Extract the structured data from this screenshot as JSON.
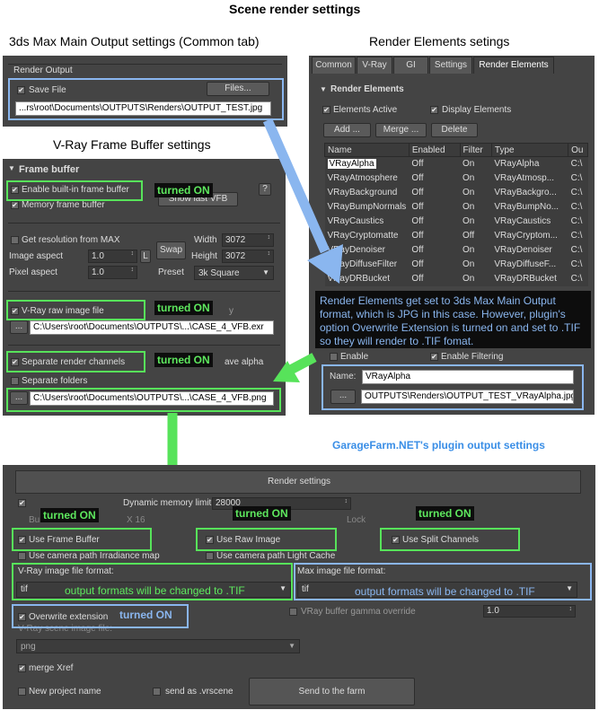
{
  "headings": {
    "main": "Scene render settings",
    "max_output": "3ds Max Main Output settings (Common tab)",
    "render_elements": "Render Elements setings",
    "vfb": "V-Ray Frame Buffer settings",
    "garagefarm": "GarageFarm.NET's plugin output settings"
  },
  "max_output": {
    "group": "Render Output",
    "save_file": "Save File",
    "files_btn": "Files...",
    "path": "...rs\\root\\Documents\\OUTPUTS\\Renders\\OUTPUT_TEST.jpg"
  },
  "render_elements": {
    "tabs": [
      "Common",
      "V-Ray",
      "GI",
      "Settings",
      "Render Elements"
    ],
    "rollout": "Render Elements",
    "elements_active": "Elements Active",
    "display_elements": "Display Elements",
    "add_btn": "Add ...",
    "merge_btn": "Merge ...",
    "delete_btn": "Delete",
    "columns": [
      "Name",
      "Enabled",
      "Filter",
      "Type",
      "Ou"
    ],
    "rows": [
      [
        "VRayAlpha",
        "Off",
        "On",
        "VRayAlpha",
        "C:\\"
      ],
      [
        "VRayAtmosphere",
        "Off",
        "On",
        "VRayAtmosp...",
        "C:\\"
      ],
      [
        "VRayBackground",
        "Off",
        "On",
        "VRayBackgro...",
        "C:\\"
      ],
      [
        "VRayBumpNormals",
        "Off",
        "On",
        "VRayBumpNo...",
        "C:\\"
      ],
      [
        "VRayCaustics",
        "Off",
        "On",
        "VRayCaustics",
        "C:\\"
      ],
      [
        "VRayCryptomatte",
        "Off",
        "Off",
        "VRayCryptom...",
        "C:\\"
      ],
      [
        "VRayDenoiser",
        "Off",
        "On",
        "VRayDenoiser",
        "C:\\"
      ],
      [
        "VRayDiffuseFilter",
        "Off",
        "On",
        "VRayDiffuseF...",
        "C:\\"
      ],
      [
        "VRayDRBucket",
        "Off",
        "On",
        "VRayDRBucket",
        "C:\\"
      ]
    ],
    "enable": "Enable",
    "enable_filtering": "Enable Filtering",
    "name_label": "Name:",
    "name_value": "VRayAlpha",
    "browse_btn": "...",
    "path": "OUTPUTS\\Renders\\OUTPUT_TEST_VRayAlpha.jpg",
    "note": "Render Elements get set to 3ds Max Main Output format, which is JPG in this case. However, plugin's option Overwrite Extension is turned on and set to .TIF so they will render to .TIF fomat."
  },
  "vfb": {
    "rollout": "Frame buffer",
    "enable_builtin": "Enable built-in frame buffer",
    "memory_fb": "Memory frame buffer",
    "show_last": "Show last VFB",
    "help_btn": "?",
    "get_res": "Get resolution from MAX",
    "image_aspect": "Image aspect",
    "image_aspect_val": "1.0",
    "l_btn": "L",
    "pixel_aspect": "Pixel aspect",
    "pixel_aspect_val": "1.0",
    "swap_btn": "Swap",
    "width_label": "Width",
    "width_val": "3072",
    "height_label": "Height",
    "height_val": "3072",
    "preset_label": "Preset",
    "preset_val": "3k Square",
    "raw_label": "V-Ray raw image file",
    "raw_suffix": "y",
    "raw_path": "C:\\Users\\root\\Documents\\OUTPUTS\\...\\CASE_4_VFB.exr",
    "sep_channels": "Separate render channels",
    "save_alpha": "ave alpha",
    "sep_folders": "Separate folders",
    "sep_path": "C:\\Users\\root\\Documents\\OUTPUTS\\...\\CASE_4_VFB.png",
    "browse_btn": "..."
  },
  "plugin": {
    "title": "Render settings",
    "dyn_mem": "Dynamic memory limit",
    "dyn_mem_val": "28000",
    "bu": "Bu",
    "x16": "X  16",
    "lock": "Lock",
    "use_fb": "Use Frame Buffer",
    "use_raw": "Use Raw Image",
    "use_split": "Use Split Channels",
    "irr_map": "Use camera path Irradiance map",
    "light_cache": "Use camera path Light Cache",
    "vray_fmt_label": "V-Ray image file format:",
    "vray_fmt_val": "tif",
    "max_fmt_label": "Max image file format:",
    "max_fmt_val": "tif",
    "overwrite": "Overwrite extension",
    "gamma": "VRay buffer gamma override",
    "gamma_val": "1.0",
    "scene_img": "V-Ray scene image file:",
    "png_val": "png",
    "merge_xref": "merge Xref",
    "new_project": "New project name",
    "send_vrscene": "send as .vrscene",
    "send_farm": "Send to the farm"
  },
  "annotations": {
    "turned_on": "turned ON",
    "fmt_note": "output formats will be changed to .TIF"
  },
  "colors": {
    "green": "#57e35a",
    "blue": "#8ab6ef",
    "panel": "#444444"
  }
}
